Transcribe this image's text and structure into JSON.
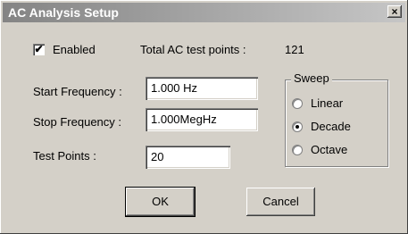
{
  "title": "AC Analysis Setup",
  "close_label": "×",
  "enabled": {
    "label": "Enabled",
    "checked": true,
    "check_mark": "✔"
  },
  "total": {
    "label": "Total  AC test points :",
    "value": "121"
  },
  "start": {
    "label": "Start Frequency :",
    "value": "1.000 Hz"
  },
  "stop": {
    "label": "Stop Frequency :",
    "value": "1.000MegHz"
  },
  "points": {
    "label": "Test Points :",
    "value": "20"
  },
  "sweep": {
    "title": "Sweep",
    "options": [
      {
        "label": "Linear",
        "selected": false
      },
      {
        "label": "Decade",
        "selected": true
      },
      {
        "label": "Octave",
        "selected": false
      }
    ]
  },
  "buttons": {
    "ok": "OK",
    "cancel": "Cancel"
  }
}
